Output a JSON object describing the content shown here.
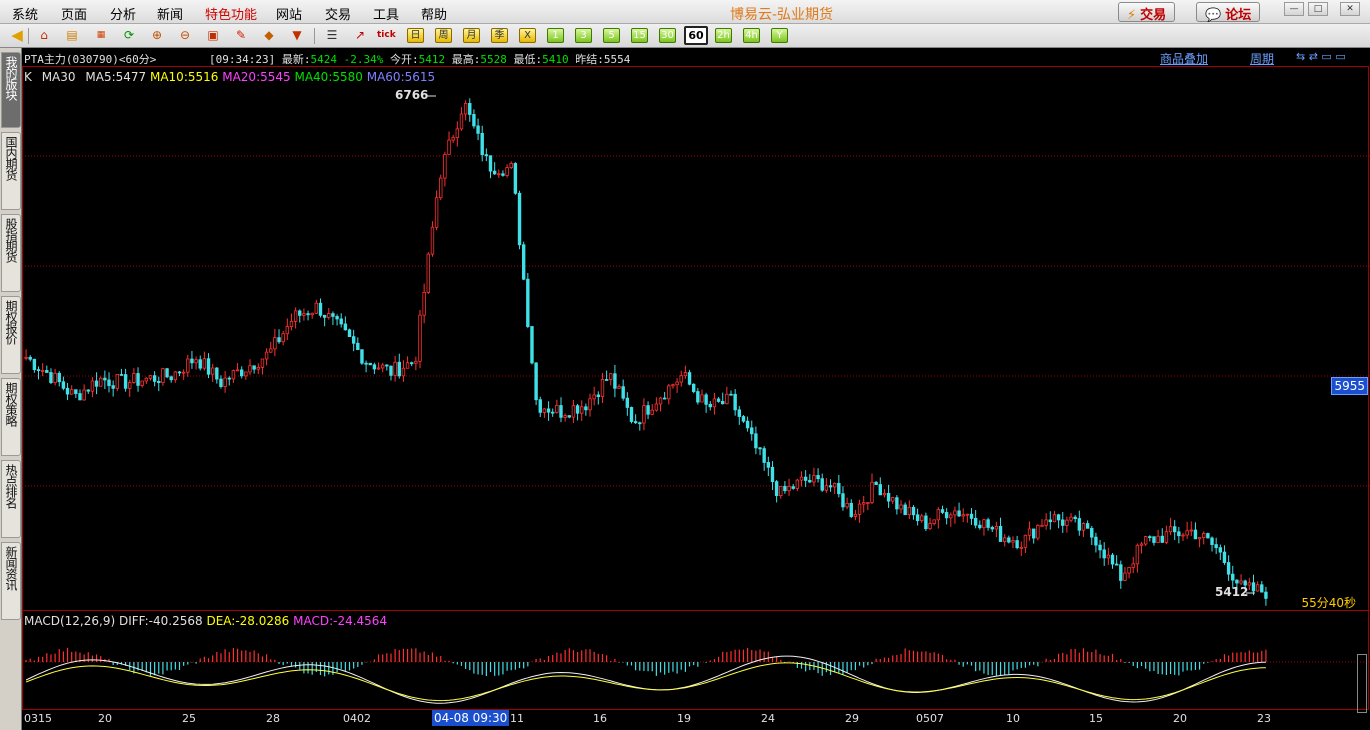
{
  "menu": {
    "items": [
      "系统",
      "页面",
      "分析",
      "新闻",
      "特色功能",
      "网站",
      "交易",
      "工具",
      "帮助"
    ],
    "highlighted": "特色功能",
    "app_title": "博易云-弘业期货",
    "trade_button": "交易",
    "forum_button": "论坛"
  },
  "toolbar": {
    "periods": [
      "日",
      "周",
      "月",
      "季",
      "X",
      "1",
      "3",
      "5",
      "15",
      "30",
      "60",
      "2h",
      "4h",
      "Y"
    ],
    "selected_period": "60"
  },
  "left_tabs": [
    "我的版块",
    "国内期货",
    "股指期货",
    "期权报价",
    "期权策略",
    "热点排名",
    "新闻资讯"
  ],
  "quote": {
    "symbol": "PTA主力(030790)<60分>",
    "time": "[09:34:23]",
    "latest_label": "最新:",
    "latest": "5424",
    "change": "-2.34%",
    "open_label": "今开:",
    "open": "5412",
    "high_label": "最高:",
    "high": "5528",
    "low_label": "最低:",
    "low": "5410",
    "prev_label": "昨结:",
    "prev": "5554",
    "overlay_link": "商品叠加",
    "period_link": "周期"
  },
  "ma_line": {
    "k": "K",
    "ma30": "MA30",
    "ma5": "MA5:5477",
    "ma10": "MA10:5516",
    "ma20": "MA20:5545",
    "ma40": "MA40:5580",
    "ma60": "MA60:5615"
  },
  "chart_annotations": {
    "max_label": "6766",
    "min_label": "5412",
    "price_tag": "5955",
    "countdown": "55分40秒"
  },
  "macd": {
    "title": "MACD(12,26,9)",
    "diff": "DIFF:-40.2568",
    "dea": "DEA:-28.0286",
    "macd": "MACD:-24.4564"
  },
  "x_axis": {
    "ticks": [
      "0315",
      "20",
      "25",
      "28",
      "0402",
      "11",
      "16",
      "19",
      "24",
      "29",
      "0507",
      "10",
      "15",
      "20",
      "23"
    ],
    "cursor_label": "04-08 09:30"
  },
  "colors": {
    "up": "#ff3030",
    "down": "#40e0e8",
    "grid": "#a00000",
    "background": "#000000"
  },
  "chart_data": {
    "type": "candlestick",
    "price_range": [
      5400,
      6790
    ],
    "values": [
      6060,
      6010,
      5950,
      6000,
      5990,
      6000,
      6010,
      6060,
      5990,
      6030,
      6070,
      6170,
      6200,
      6130,
      6050,
      6020,
      6050,
      6560,
      6766,
      6590,
      6580,
      5930,
      5910,
      5930,
      6010,
      5880,
      5950,
      6010,
      5920,
      5940,
      5810,
      5680,
      5720,
      5710,
      5630,
      5710,
      5640,
      5600,
      5640,
      5620,
      5570,
      5550,
      5620,
      5600,
      5560,
      5450,
      5550,
      5570,
      5580,
      5530,
      5420,
      5412
    ]
  }
}
